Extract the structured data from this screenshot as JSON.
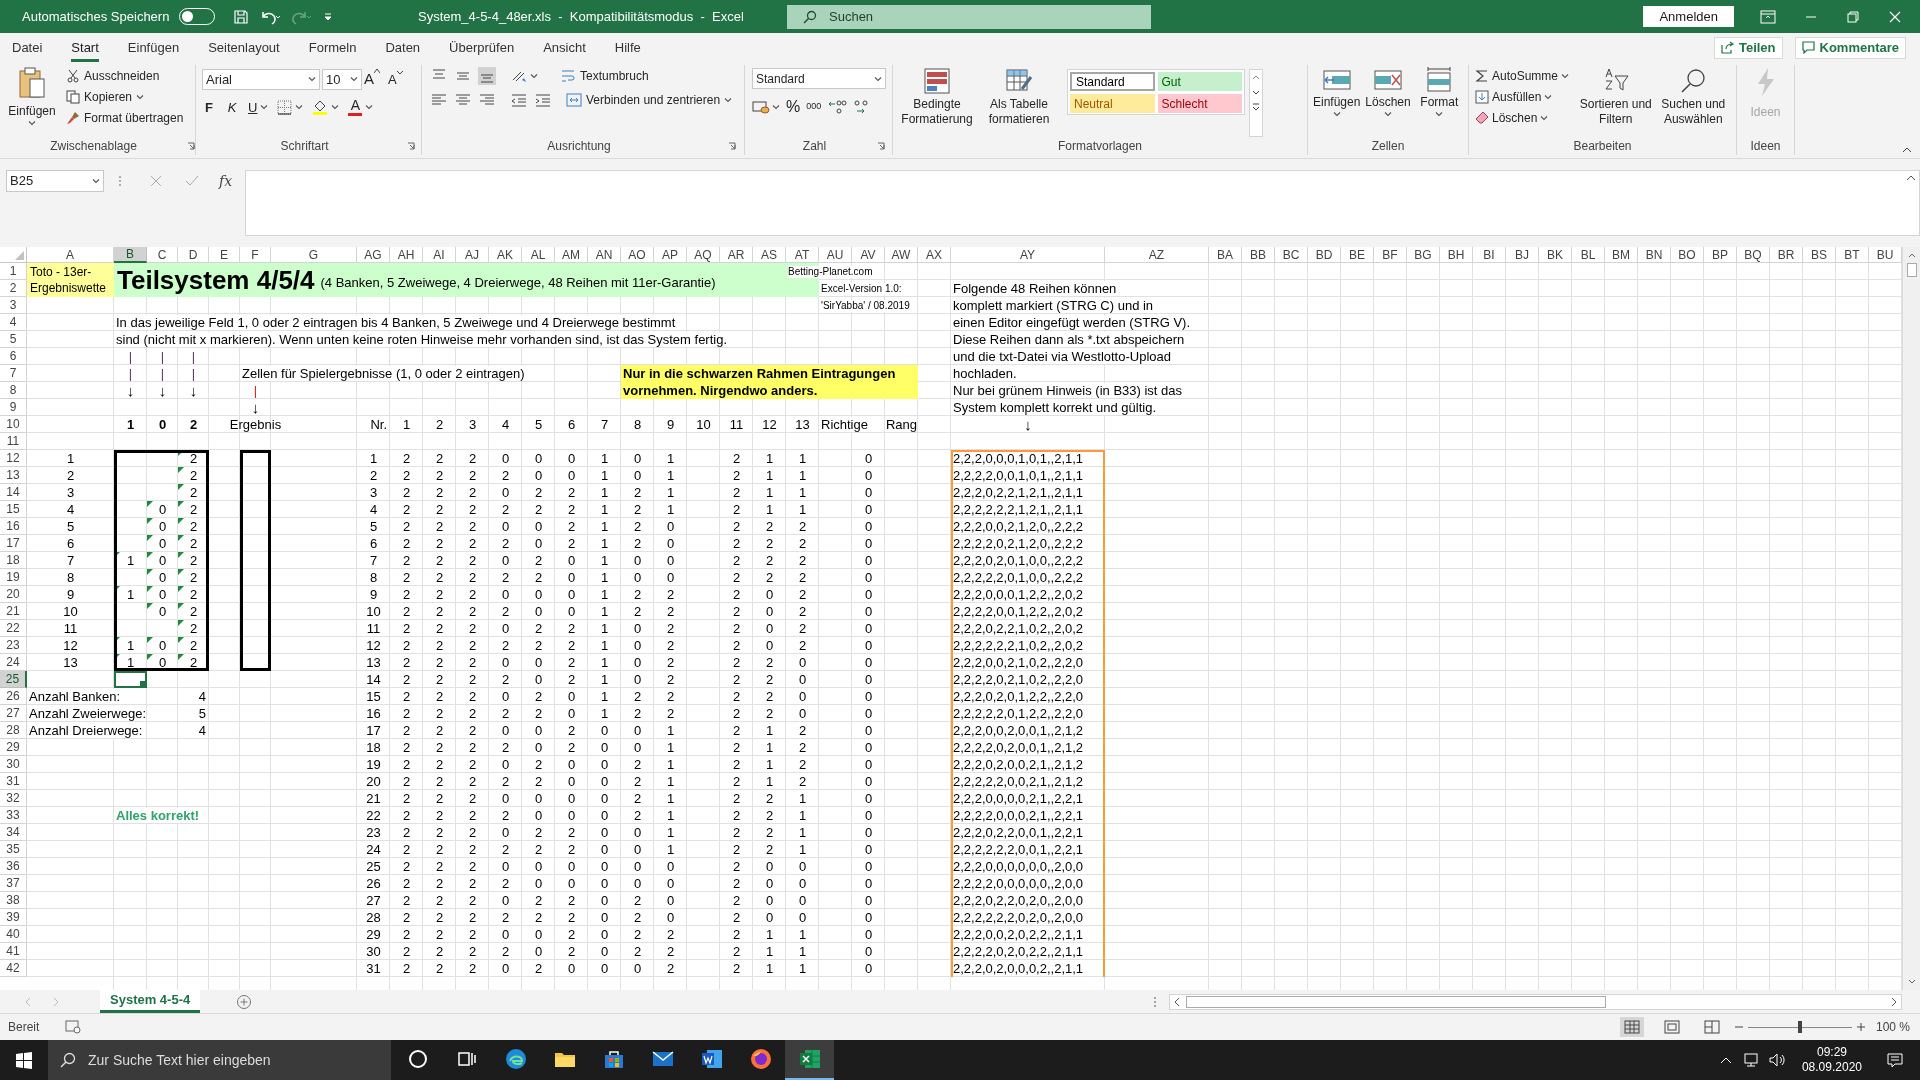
{
  "title_bar": {
    "autosave_label": "Automatisches Speichern",
    "autosave_on": false,
    "title": "System_4-5-4_48er.xls  -  Kompatibilitätsmodus  -  Excel",
    "search_placeholder": "Suchen",
    "sign_in": "Anmelden"
  },
  "menu_tabs": [
    {
      "label": "Datei",
      "selected": false
    },
    {
      "label": "Start",
      "selected": true
    },
    {
      "label": "Einfügen",
      "selected": false
    },
    {
      "label": "Seitenlayout",
      "selected": false
    },
    {
      "label": "Formeln",
      "selected": false
    },
    {
      "label": "Daten",
      "selected": false
    },
    {
      "label": "Überprüfen",
      "selected": false
    },
    {
      "label": "Ansicht",
      "selected": false
    },
    {
      "label": "Hilfe",
      "selected": false
    }
  ],
  "share": "Teilen",
  "comments": "Kommentare",
  "ribbon": {
    "clipboard": {
      "paste": "Einfügen",
      "cut": "Ausschneiden",
      "copy": "Kopieren",
      "painter": "Format übertragen",
      "group": "Zwischenablage"
    },
    "font": {
      "name": "Arial",
      "size": "10",
      "grow": "A",
      "shrink": "A",
      "bold": "F",
      "italic": "K",
      "underline": "U",
      "text_tint": "A",
      "group": "Schriftart"
    },
    "alignment": {
      "wrap": "Textumbruch",
      "merge": "Verbinden und zentrieren",
      "group": "Ausrichtung"
    },
    "number": {
      "format": "Standard",
      "percent": "%",
      "thousands": "000",
      "group": "Zahl"
    },
    "styles": {
      "conditional": "Bedingte Formatierung",
      "as_table": "Als Tabelle formatieren",
      "gallery": [
        {
          "label": "Standard",
          "kind": "standard"
        },
        {
          "label": "Gut",
          "kind": "good"
        },
        {
          "label": "Neutral",
          "kind": "neutral"
        },
        {
          "label": "Schlecht",
          "kind": "bad"
        }
      ],
      "group": "Formatvorlagen"
    },
    "cells": {
      "insert": "Einfügen",
      "delete": "Löschen",
      "format": "Format",
      "group": "Zellen"
    },
    "editing": {
      "autosum": "AutoSumme",
      "fill": "Ausfüllen",
      "clear": "Löschen",
      "sort": "Sortieren und Filtern",
      "find": "Suchen und Auswählen",
      "group": "Bearbeiten"
    },
    "ideas": {
      "label": "Ideen",
      "disabled": true,
      "group": "Ideen"
    }
  },
  "formula_bar": {
    "name_box": "B25",
    "fx": "fx"
  },
  "sheet": {
    "columns": [
      {
        "label": "A",
        "selected": false
      },
      {
        "label": "B",
        "selected": true
      },
      {
        "label": "C",
        "selected": false
      },
      {
        "label": "D",
        "selected": false
      },
      {
        "label": "E",
        "selected": false
      },
      {
        "label": "F",
        "selected": false
      },
      {
        "label": "G",
        "selected": false
      },
      {
        "label": "AG",
        "selected": false
      },
      {
        "label": "AH",
        "selected": false
      },
      {
        "label": "AI",
        "selected": false
      },
      {
        "label": "AJ",
        "selected": false
      },
      {
        "label": "AK",
        "selected": false
      },
      {
        "label": "AL",
        "selected": false
      },
      {
        "label": "AM",
        "selected": false
      },
      {
        "label": "AN",
        "selected": false
      },
      {
        "label": "AO",
        "selected": false
      },
      {
        "label": "AP",
        "selected": false
      },
      {
        "label": "AQ",
        "selected": false
      },
      {
        "label": "AR",
        "selected": false
      },
      {
        "label": "AS",
        "selected": false
      },
      {
        "label": "AT",
        "selected": false
      },
      {
        "label": "AU",
        "selected": false
      },
      {
        "label": "AV",
        "selected": false
      },
      {
        "label": "AW",
        "selected": false
      },
      {
        "label": "AX",
        "selected": false
      },
      {
        "label": "AY",
        "selected": false
      },
      {
        "label": "AZ",
        "selected": false
      },
      {
        "label": "BA",
        "selected": false
      },
      {
        "label": "BB",
        "selected": false
      },
      {
        "label": "BC",
        "selected": false
      },
      {
        "label": "BD",
        "selected": false
      },
      {
        "label": "BE",
        "selected": false
      },
      {
        "label": "BF",
        "selected": false
      },
      {
        "label": "BG",
        "selected": false
      },
      {
        "label": "BH",
        "selected": false
      },
      {
        "label": "BI",
        "selected": false
      },
      {
        "label": "BJ",
        "selected": false
      },
      {
        "label": "BK",
        "selected": false
      },
      {
        "label": "BL",
        "selected": false
      },
      {
        "label": "BM",
        "selected": false
      },
      {
        "label": "BN",
        "selected": false
      },
      {
        "label": "BO",
        "selected": false
      },
      {
        "label": "BP",
        "selected": false
      },
      {
        "label": "BQ",
        "selected": false
      },
      {
        "label": "BR",
        "selected": false
      },
      {
        "label": "BS",
        "selected": false
      },
      {
        "label": "BT",
        "selected": false
      },
      {
        "label": "BU",
        "selected": false
      }
    ],
    "rows": [
      {
        "header": "1",
        "selected": false,
        "cells": [
          {
            "text": "Toto - 13er-Ergebniswette",
            "kind": "label"
          },
          {
            "text": "Teilsystem 4/5/4",
            "kind": "title",
            "subtitle": "(4 Banken, 5 Zweiwege, 4 Dreierwege, 48 Reihen mit 11er-Garantie)"
          },
          null,
          null,
          null,
          null,
          null,
          null,
          null,
          null,
          null,
          null,
          null,
          null,
          null,
          null,
          null,
          null,
          null,
          null,
          {
            "text": "Betting-Planet.com",
            "kind": "small"
          }
        ]
      },
      {
        "header": "2",
        "selected": false,
        "cells": [
          null,
          null,
          null,
          null,
          null,
          null,
          null,
          null,
          null,
          null,
          null,
          null,
          null,
          null,
          null,
          null,
          null,
          null,
          null,
          null,
          null,
          {
            "text": "Excel-Version 1.0:",
            "kind": "small"
          },
          null,
          null,
          null,
          "Folgende 48 Reihen können"
        ]
      },
      {
        "header": "3",
        "selected": false,
        "cells": [
          null,
          null,
          null,
          null,
          null,
          null,
          null,
          null,
          null,
          null,
          null,
          null,
          null,
          null,
          null,
          null,
          null,
          null,
          null,
          null,
          null,
          {
            "text": "'SirYabba' / 08.2019",
            "kind": "small"
          },
          null,
          null,
          null,
          "komplett markiert (STRG C) und in"
        ]
      },
      {
        "header": "4",
        "selected": false,
        "cells": [
          null,
          "In das jeweilige Feld 1, 0 oder 2 eintragen bis 4 Banken, 5 Zweiwege und 4 Dreierwege bestimmt",
          null,
          null,
          null,
          null,
          null,
          null,
          null,
          null,
          null,
          null,
          null,
          null,
          null,
          null,
          null,
          null,
          null,
          null,
          null,
          null,
          null,
          null,
          null,
          "einen Editor eingefügt werden (STRG V)."
        ]
      },
      {
        "header": "5",
        "selected": false,
        "cells": [
          null,
          "sind (nicht mit x markieren). Wenn unten keine roten Hinweise mehr vorhanden sind, ist das System fertig.",
          null,
          null,
          null,
          null,
          null,
          null,
          null,
          null,
          null,
          null,
          null,
          null,
          null,
          null,
          null,
          null,
          null,
          null,
          null,
          null,
          null,
          null,
          null,
          "Diese Reihen dann als *.txt abspeichern"
        ]
      },
      {
        "header": "6",
        "selected": false,
        "cells": [
          null,
          {
            "text": "|",
            "kind": "bar"
          },
          {
            "text": "|",
            "kind": "bar"
          },
          {
            "text": "|",
            "kind": "bar"
          },
          null,
          null,
          null,
          null,
          null,
          null,
          null,
          null,
          null,
          null,
          null,
          null,
          null,
          null,
          null,
          null,
          null,
          null,
          null,
          null,
          null,
          "und die txt-Datei via Westlotto-Upload"
        ]
      },
      {
        "header": "7",
        "selected": false,
        "cells": [
          null,
          {
            "text": "|",
            "kind": "bar"
          },
          {
            "text": "|",
            "kind": "bar"
          },
          {
            "text": "|",
            "kind": "bar"
          },
          null,
          "Zellen für Spielergebnisse (1, 0 oder 2 eintragen)",
          null,
          null,
          null,
          null,
          null,
          null,
          null,
          null,
          null,
          {
            "text": "Nur in die schwarzen Rahmen Eintragungen",
            "kind": "note"
          },
          null,
          null,
          null,
          null,
          null,
          null,
          null,
          null,
          null,
          "hochladen."
        ]
      },
      {
        "header": "8",
        "selected": false,
        "cells": [
          null,
          {
            "text": "↓",
            "kind": "arrow"
          },
          {
            "text": "↓",
            "kind": "arrow"
          },
          {
            "text": "↓",
            "kind": "arrow"
          },
          null,
          {
            "text": "|",
            "kind": "bar_red"
          },
          null,
          null,
          null,
          null,
          null,
          null,
          null,
          null,
          null,
          {
            "text": "vornehmen. Nirgendwo anders.",
            "kind": "note"
          },
          null,
          null,
          null,
          null,
          null,
          null,
          null,
          null,
          null,
          "Nur bei grünem Hinweis (in B33) ist das"
        ]
      },
      {
        "header": "9",
        "selected": false,
        "cells": [
          null,
          null,
          null,
          null,
          null,
          {
            "text": "↓",
            "kind": "arrow"
          },
          null,
          null,
          null,
          null,
          null,
          null,
          null,
          null,
          null,
          null,
          null,
          null,
          null,
          null,
          null,
          null,
          null,
          null,
          null,
          "System komplett korrekt und gültig."
        ]
      },
      {
        "header": "10",
        "selected": false,
        "cells": [
          null,
          {
            "text": "1",
            "kind": "bold"
          },
          {
            "text": "0",
            "kind": "bold"
          },
          {
            "text": "2",
            "kind": "bold"
          },
          null,
          {
            "text": "Ergebnis",
            "kind": "center"
          },
          null,
          {
            "text": "Nr.",
            "kind": "right"
          },
          "1",
          "2",
          "3",
          "4",
          "5",
          "6",
          "7",
          "8",
          "9",
          "10",
          "11",
          "12",
          "13",
          {
            "text": "Richtige",
            "kind": "left"
          },
          null,
          "Rang",
          null,
          {
            "text": "↓",
            "kind": "arrow"
          }
        ]
      },
      {
        "header": "11",
        "selected": false
      },
      {
        "header": "12",
        "selected": false,
        "cells": [
          {
            "text": "1",
            "kind": "center"
          },
          null,
          null,
          {
            "text": "2",
            "kind": "entry"
          },
          null,
          null,
          null,
          "1",
          "2",
          "2",
          "2",
          "0",
          "0",
          "0",
          "1",
          "0",
          "1",
          null,
          "2",
          "1",
          "1",
          null,
          "0",
          null,
          null,
          "2,2,2,0,0,0,1,0,1,,2,1,1"
        ]
      },
      {
        "header": "13",
        "selected": false,
        "cells": [
          {
            "text": "2",
            "kind": "center"
          },
          null,
          null,
          {
            "text": "2",
            "kind": "entry"
          },
          null,
          null,
          null,
          "2",
          "2",
          "2",
          "2",
          "2",
          "0",
          "0",
          "1",
          "0",
          "1",
          null,
          "2",
          "1",
          "1",
          null,
          "0",
          null,
          null,
          "2,2,2,2,0,0,1,0,1,,2,1,1"
        ]
      },
      {
        "header": "14",
        "selected": false,
        "cells": [
          {
            "text": "3",
            "kind": "center"
          },
          null,
          null,
          {
            "text": "2",
            "kind": "entry"
          },
          null,
          null,
          null,
          "3",
          "2",
          "2",
          "2",
          "0",
          "2",
          "2",
          "1",
          "2",
          "1",
          null,
          "2",
          "1",
          "1",
          null,
          "0",
          null,
          null,
          "2,2,2,0,2,2,1,2,1,,2,1,1"
        ]
      },
      {
        "header": "15",
        "selected": false,
        "cells": [
          {
            "text": "4",
            "kind": "center"
          },
          null,
          {
            "text": "0",
            "kind": "entry"
          },
          {
            "text": "2",
            "kind": "entry"
          },
          null,
          null,
          null,
          "4",
          "2",
          "2",
          "2",
          "2",
          "2",
          "2",
          "1",
          "2",
          "1",
          null,
          "2",
          "1",
          "1",
          null,
          "0",
          null,
          null,
          "2,2,2,2,2,2,1,2,1,,2,1,1"
        ]
      },
      {
        "header": "16",
        "selected": false,
        "cells": [
          {
            "text": "5",
            "kind": "center"
          },
          null,
          {
            "text": "0",
            "kind": "entry"
          },
          {
            "text": "2",
            "kind": "entry"
          },
          null,
          null,
          null,
          "5",
          "2",
          "2",
          "2",
          "0",
          "0",
          "2",
          "1",
          "2",
          "0",
          null,
          "2",
          "2",
          "2",
          null,
          "0",
          null,
          null,
          "2,2,2,0,0,2,1,2,0,,2,2,2"
        ]
      },
      {
        "header": "17",
        "selected": false,
        "cells": [
          {
            "text": "6",
            "kind": "center"
          },
          null,
          {
            "text": "0",
            "kind": "entry"
          },
          {
            "text": "2",
            "kind": "entry"
          },
          null,
          null,
          null,
          "6",
          "2",
          "2",
          "2",
          "2",
          "0",
          "2",
          "1",
          "2",
          "0",
          null,
          "2",
          "2",
          "2",
          null,
          "0",
          null,
          null,
          "2,2,2,2,0,2,1,2,0,,2,2,2"
        ]
      },
      {
        "header": "18",
        "selected": false,
        "cells": [
          {
            "text": "7",
            "kind": "center"
          },
          {
            "text": "1",
            "kind": "entry"
          },
          {
            "text": "0",
            "kind": "entry"
          },
          {
            "text": "2",
            "kind": "entry"
          },
          null,
          null,
          null,
          "7",
          "2",
          "2",
          "2",
          "0",
          "2",
          "0",
          "1",
          "0",
          "0",
          null,
          "2",
          "2",
          "2",
          null,
          "0",
          null,
          null,
          "2,2,2,0,2,0,1,0,0,,2,2,2"
        ]
      },
      {
        "header": "19",
        "selected": false,
        "cells": [
          {
            "text": "8",
            "kind": "center"
          },
          null,
          {
            "text": "0",
            "kind": "entry"
          },
          {
            "text": "2",
            "kind": "entry"
          },
          null,
          null,
          null,
          "8",
          "2",
          "2",
          "2",
          "2",
          "2",
          "0",
          "1",
          "0",
          "0",
          null,
          "2",
          "2",
          "2",
          null,
          "0",
          null,
          null,
          "2,2,2,2,2,0,1,0,0,,2,2,2"
        ]
      },
      {
        "header": "20",
        "selected": false,
        "cells": [
          {
            "text": "9",
            "kind": "center"
          },
          {
            "text": "1",
            "kind": "entry"
          },
          {
            "text": "0",
            "kind": "entry"
          },
          {
            "text": "2",
            "kind": "entry"
          },
          null,
          null,
          null,
          "9",
          "2",
          "2",
          "2",
          "0",
          "0",
          "0",
          "1",
          "2",
          "2",
          null,
          "2",
          "0",
          "2",
          null,
          "0",
          null,
          null,
          "2,2,2,0,0,0,1,2,2,,2,0,2"
        ]
      },
      {
        "header": "21",
        "selected": false,
        "cells": [
          {
            "text": "10",
            "kind": "center"
          },
          null,
          {
            "text": "0",
            "kind": "entry"
          },
          {
            "text": "2",
            "kind": "entry"
          },
          null,
          null,
          null,
          "10",
          "2",
          "2",
          "2",
          "2",
          "0",
          "0",
          "1",
          "2",
          "2",
          null,
          "2",
          "0",
          "2",
          null,
          "0",
          null,
          null,
          "2,2,2,2,0,0,1,2,2,,2,0,2"
        ]
      },
      {
        "header": "22",
        "selected": false,
        "cells": [
          {
            "text": "11",
            "kind": "center"
          },
          null,
          null,
          {
            "text": "2",
            "kind": "entry"
          },
          null,
          null,
          null,
          "11",
          "2",
          "2",
          "2",
          "0",
          "2",
          "2",
          "1",
          "0",
          "2",
          null,
          "2",
          "0",
          "2",
          null,
          "0",
          null,
          null,
          "2,2,2,0,2,2,1,0,2,,2,0,2"
        ]
      },
      {
        "header": "23",
        "selected": false,
        "cells": [
          {
            "text": "12",
            "kind": "center"
          },
          {
            "text": "1",
            "kind": "entry"
          },
          {
            "text": "0",
            "kind": "entry"
          },
          {
            "text": "2",
            "kind": "entry"
          },
          null,
          null,
          null,
          "12",
          "2",
          "2",
          "2",
          "2",
          "2",
          "2",
          "1",
          "0",
          "2",
          null,
          "2",
          "0",
          "2",
          null,
          "0",
          null,
          null,
          "2,2,2,2,2,2,1,0,2,,2,0,2"
        ]
      },
      {
        "header": "24",
        "selected": false,
        "cells": [
          {
            "text": "13",
            "kind": "center"
          },
          {
            "text": "1",
            "kind": "entry"
          },
          {
            "text": "0",
            "kind": "entry"
          },
          {
            "text": "2",
            "kind": "entry"
          },
          null,
          null,
          null,
          "13",
          "2",
          "2",
          "2",
          "0",
          "0",
          "2",
          "1",
          "0",
          "2",
          null,
          "2",
          "2",
          "0",
          null,
          "0",
          null,
          null,
          "2,2,2,0,0,2,1,0,2,,2,2,0"
        ]
      },
      {
        "header": "25",
        "selected": true,
        "cells": [
          null,
          null,
          null,
          null,
          null,
          null,
          null,
          "14",
          "2",
          "2",
          "2",
          "2",
          "0",
          "2",
          "1",
          "0",
          "2",
          null,
          "2",
          "2",
          "0",
          null,
          "0",
          null,
          null,
          "2,2,2,2,0,2,1,0,2,,2,2,0"
        ]
      },
      {
        "header": "26",
        "selected": false,
        "cells": [
          "Anzahl Banken:",
          null,
          null,
          {
            "text": "4",
            "kind": "right"
          },
          null,
          null,
          null,
          "15",
          "2",
          "2",
          "2",
          "0",
          "2",
          "0",
          "1",
          "2",
          "2",
          null,
          "2",
          "2",
          "0",
          null,
          "0",
          null,
          null,
          "2,2,2,0,2,0,1,2,2,,2,2,0"
        ]
      },
      {
        "header": "27",
        "selected": false,
        "cells": [
          "Anzahl Zweierwege:",
          null,
          null,
          {
            "text": "5",
            "kind": "right"
          },
          null,
          null,
          null,
          "16",
          "2",
          "2",
          "2",
          "2",
          "2",
          "0",
          "1",
          "2",
          "2",
          null,
          "2",
          "2",
          "0",
          null,
          "0",
          null,
          null,
          "2,2,2,2,2,0,1,2,2,,2,2,0"
        ]
      },
      {
        "header": "28",
        "selected": false,
        "cells": [
          "Anzahl Dreierwege:",
          null,
          null,
          {
            "text": "4",
            "kind": "right"
          },
          null,
          null,
          null,
          "17",
          "2",
          "2",
          "2",
          "0",
          "0",
          "2",
          "0",
          "0",
          "1",
          null,
          "2",
          "1",
          "2",
          null,
          "0",
          null,
          null,
          "2,2,2,0,0,2,0,0,1,,2,1,2"
        ]
      },
      {
        "header": "29",
        "selected": false,
        "cells": [
          null,
          null,
          null,
          null,
          null,
          null,
          null,
          "18",
          "2",
          "2",
          "2",
          "2",
          "0",
          "2",
          "0",
          "0",
          "1",
          null,
          "2",
          "1",
          "2",
          null,
          "0",
          null,
          null,
          "2,2,2,2,0,2,0,0,1,,2,1,2"
        ]
      },
      {
        "header": "30",
        "selected": false,
        "cells": [
          null,
          null,
          null,
          null,
          null,
          null,
          null,
          "19",
          "2",
          "2",
          "2",
          "0",
          "2",
          "0",
          "0",
          "2",
          "1",
          null,
          "2",
          "1",
          "2",
          null,
          "0",
          null,
          null,
          "2,2,2,0,2,0,0,2,1,,2,1,2"
        ]
      },
      {
        "header": "31",
        "selected": false,
        "cells": [
          null,
          null,
          null,
          null,
          null,
          null,
          null,
          "20",
          "2",
          "2",
          "2",
          "2",
          "2",
          "0",
          "0",
          "2",
          "1",
          null,
          "2",
          "1",
          "2",
          null,
          "0",
          null,
          null,
          "2,2,2,2,2,0,0,2,1,,2,1,2"
        ]
      },
      {
        "header": "32",
        "selected": false,
        "cells": [
          null,
          null,
          null,
          null,
          null,
          null,
          null,
          "21",
          "2",
          "2",
          "2",
          "0",
          "0",
          "0",
          "0",
          "2",
          "1",
          null,
          "2",
          "2",
          "1",
          null,
          "0",
          null,
          null,
          "2,2,2,0,0,0,0,2,1,,2,2,1"
        ]
      },
      {
        "header": "33",
        "selected": false,
        "cells": [
          null,
          {
            "text": "Alles korrekt!",
            "kind": "ok"
          },
          null,
          null,
          null,
          null,
          null,
          "22",
          "2",
          "2",
          "2",
          "2",
          "0",
          "0",
          "0",
          "2",
          "1",
          null,
          "2",
          "2",
          "1",
          null,
          "0",
          null,
          null,
          "2,2,2,2,0,0,0,2,1,,2,2,1"
        ]
      },
      {
        "header": "34",
        "selected": false,
        "cells": [
          null,
          null,
          null,
          null,
          null,
          null,
          null,
          "23",
          "2",
          "2",
          "2",
          "0",
          "2",
          "2",
          "0",
          "0",
          "1",
          null,
          "2",
          "2",
          "1",
          null,
          "0",
          null,
          null,
          "2,2,2,0,2,2,0,0,1,,2,2,1"
        ]
      },
      {
        "header": "35",
        "selected": false,
        "cells": [
          null,
          null,
          null,
          null,
          null,
          null,
          null,
          "24",
          "2",
          "2",
          "2",
          "2",
          "2",
          "2",
          "0",
          "0",
          "1",
          null,
          "2",
          "2",
          "1",
          null,
          "0",
          null,
          null,
          "2,2,2,2,2,2,0,0,1,,2,2,1"
        ]
      },
      {
        "header": "36",
        "selected": false,
        "cells": [
          null,
          null,
          null,
          null,
          null,
          null,
          null,
          "25",
          "2",
          "2",
          "2",
          "0",
          "0",
          "0",
          "0",
          "0",
          "0",
          null,
          "2",
          "0",
          "0",
          null,
          "0",
          null,
          null,
          "2,2,2,0,0,0,0,0,0,,2,0,0"
        ]
      },
      {
        "header": "37",
        "selected": false,
        "cells": [
          null,
          null,
          null,
          null,
          null,
          null,
          null,
          "26",
          "2",
          "2",
          "2",
          "2",
          "0",
          "0",
          "0",
          "0",
          "0",
          null,
          "2",
          "0",
          "0",
          null,
          "0",
          null,
          null,
          "2,2,2,2,0,0,0,0,0,,2,0,0"
        ]
      },
      {
        "header": "38",
        "selected": false,
        "cells": [
          null,
          null,
          null,
          null,
          null,
          null,
          null,
          "27",
          "2",
          "2",
          "2",
          "0",
          "2",
          "2",
          "0",
          "2",
          "0",
          null,
          "2",
          "0",
          "0",
          null,
          "0",
          null,
          null,
          "2,2,2,0,2,2,0,2,0,,2,0,0"
        ]
      },
      {
        "header": "39",
        "selected": false,
        "cells": [
          null,
          null,
          null,
          null,
          null,
          null,
          null,
          "28",
          "2",
          "2",
          "2",
          "2",
          "2",
          "2",
          "0",
          "2",
          "0",
          null,
          "2",
          "0",
          "0",
          null,
          "0",
          null,
          null,
          "2,2,2,2,2,2,0,2,0,,2,0,0"
        ]
      },
      {
        "header": "40",
        "selected": false,
        "cells": [
          null,
          null,
          null,
          null,
          null,
          null,
          null,
          "29",
          "2",
          "2",
          "2",
          "0",
          "0",
          "2",
          "0",
          "2",
          "2",
          null,
          "2",
          "1",
          "1",
          null,
          "0",
          null,
          null,
          "2,2,2,0,0,2,0,2,2,,2,1,1"
        ]
      },
      {
        "header": "41",
        "selected": false,
        "cells": [
          null,
          null,
          null,
          null,
          null,
          null,
          null,
          "30",
          "2",
          "2",
          "2",
          "2",
          "0",
          "2",
          "0",
          "2",
          "2",
          null,
          "2",
          "1",
          "1",
          null,
          "0",
          null,
          null,
          "2,2,2,2,0,2,0,2,2,,2,1,1"
        ]
      },
      {
        "header": "42",
        "selected": false,
        "cells": [
          null,
          null,
          null,
          null,
          null,
          null,
          null,
          "31",
          "2",
          "2",
          "2",
          "0",
          "2",
          "0",
          "0",
          "0",
          "2",
          null,
          "2",
          "1",
          "1",
          null,
          "0",
          null,
          null,
          "2,2,2,0,2,0,0,0,2,,2,1,1"
        ]
      }
    ]
  },
  "sheet_tabs": [
    {
      "label": "System 4-5-4",
      "selected": true
    }
  ],
  "status_bar": {
    "status": "Bereit",
    "zoom": {
      "level": 0.5,
      "reading": "100 %"
    }
  },
  "taskbar": {
    "search_placeholder": "Zur Suche Text hier eingeben",
    "apps": [
      {
        "kind": "circle",
        "selected": false
      },
      {
        "kind": "task_view",
        "selected": false
      },
      {
        "kind": "edge",
        "selected": false
      },
      {
        "kind": "folder",
        "selected": false
      },
      {
        "kind": "store",
        "selected": false
      },
      {
        "kind": "mail",
        "selected": false
      },
      {
        "kind": "word",
        "selected": false
      },
      {
        "kind": "firefox",
        "selected": false
      },
      {
        "kind": "excel",
        "selected": true
      }
    ],
    "time": "09:29",
    "date": "08.09.2020"
  }
}
